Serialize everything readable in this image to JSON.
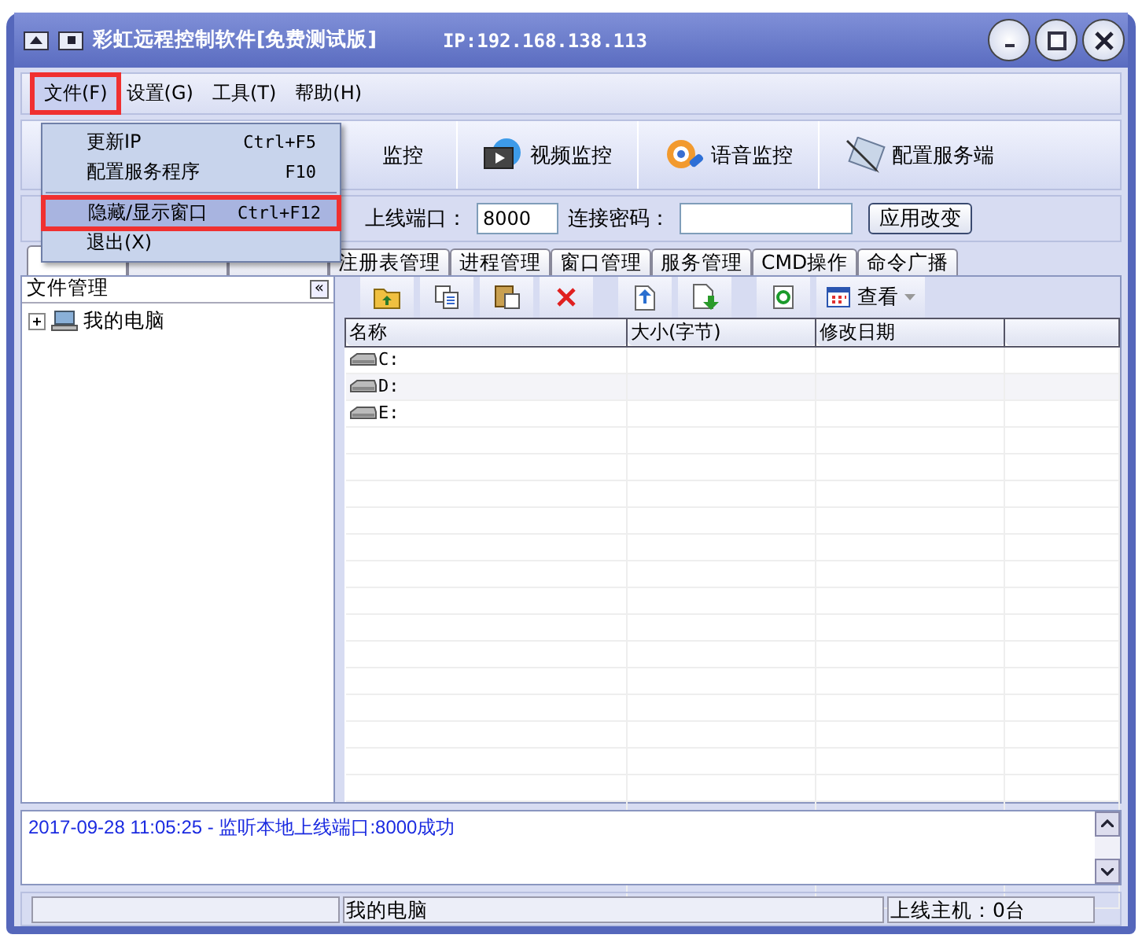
{
  "window": {
    "title": "彩虹远程控制软件[免费测试版]",
    "ip": "IP:192.168.138.113"
  },
  "menu_bar": [
    {
      "label": "文件(F)",
      "open": true,
      "annotated": true
    },
    {
      "label": "设置(G)",
      "open": false,
      "annotated": false
    },
    {
      "label": "工具(T)",
      "open": false,
      "annotated": false
    },
    {
      "label": "帮助(H)",
      "open": false,
      "annotated": false
    }
  ],
  "file_menu": [
    {
      "kind": "item",
      "label": "更新IP",
      "shortcut": "Ctrl+F5",
      "selected": false,
      "annotated": false
    },
    {
      "kind": "item",
      "label": "配置服务程序",
      "shortcut": "F10",
      "selected": false,
      "annotated": false
    },
    {
      "kind": "separator"
    },
    {
      "kind": "item",
      "label": "隐藏/显示窗口",
      "shortcut": "Ctrl+F12",
      "selected": true,
      "annotated": true
    },
    {
      "kind": "item",
      "label": "退出(X)",
      "selected": false,
      "annotated": false
    }
  ],
  "toolbar": [
    {
      "kind": "screen",
      "label": "监控"
    },
    {
      "kind": "video",
      "label": "视频监控"
    },
    {
      "kind": "voice",
      "label": "语音监控"
    },
    {
      "kind": "config",
      "label": "配置服务端"
    }
  ],
  "connection": {
    "port_label": "上线端口：",
    "port": "8000",
    "password_label": "连接密码：",
    "apply": "应用改变"
  },
  "tabs": [
    {
      "selected": true
    },
    {
      "selected": false
    },
    {
      "selected": false
    },
    {
      "label": "注册表管理",
      "selected": false
    },
    {
      "label": "进程管理",
      "selected": false
    },
    {
      "label": "窗口管理",
      "selected": false
    },
    {
      "label": "服务管理",
      "selected": false
    },
    {
      "label": "CMD操作",
      "selected": false
    },
    {
      "label": "命令广播",
      "selected": false
    }
  ],
  "tree_panel": {
    "title": "文件管理",
    "collapse": "«",
    "tree": [
      {
        "label": "我的电脑",
        "expanded": false
      }
    ]
  },
  "file_toolbar": [
    {
      "kind": "up"
    },
    {
      "kind": "copy"
    },
    {
      "kind": "paste"
    },
    {
      "kind": "delete"
    },
    {
      "kind": "upload"
    },
    {
      "kind": "download"
    },
    {
      "kind": "refresh"
    },
    {
      "kind": "view",
      "label": "查看"
    }
  ],
  "table": {
    "columns": [
      "名称",
      "大小(字节)",
      "修改日期"
    ],
    "rows": [
      {
        "name": "C:"
      },
      {
        "name": "D:"
      },
      {
        "name": "E:"
      }
    ]
  },
  "log": [
    "2017-09-28 11:05:25 - 监听本地上线端口:8000成功"
  ],
  "status_bar": {
    "section_2": "我的电脑",
    "section_3": "上线主机：0台"
  }
}
